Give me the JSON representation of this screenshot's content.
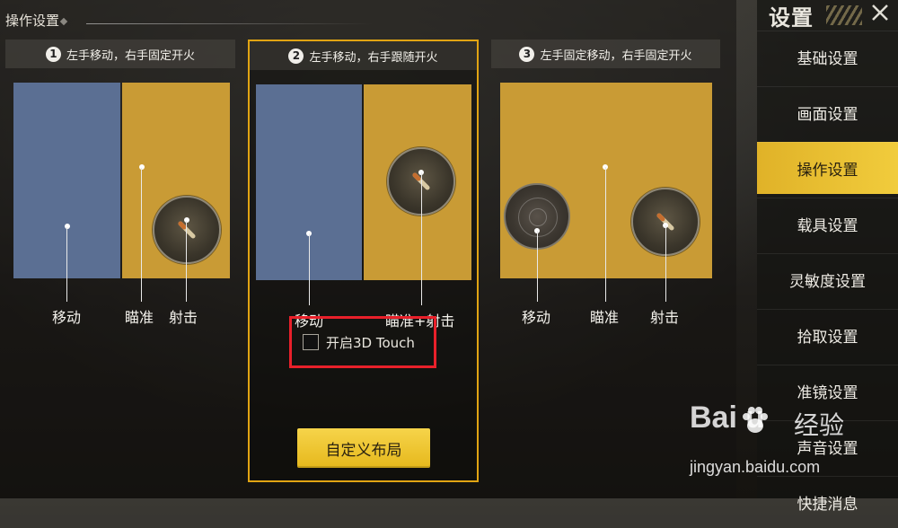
{
  "header": {
    "title": "操作设置"
  },
  "schemes": [
    {
      "num": "1",
      "title": "左手移动，右手固定开火",
      "labels": {
        "move": "移动",
        "aim": "瞄准",
        "fire": "射击"
      }
    },
    {
      "num": "2",
      "title": "左手移动，右手跟随开火",
      "labels": {
        "move": "移动",
        "aim_fire": "瞄准+射击"
      }
    },
    {
      "num": "3",
      "title": "左手固定移动，右手固定开火",
      "labels": {
        "move": "移动",
        "aim": "瞄准",
        "fire": "射击"
      }
    }
  ],
  "touch3d": {
    "label": "开启3D Touch",
    "checked": false
  },
  "custom_layout_button": "自定义布局",
  "sidebar": {
    "title": "设置",
    "items": [
      {
        "label": "基础设置",
        "active": false
      },
      {
        "label": "画面设置",
        "active": false
      },
      {
        "label": "操作设置",
        "active": true
      },
      {
        "label": "载具设置",
        "active": false
      },
      {
        "label": "灵敏度设置",
        "active": false
      },
      {
        "label": "拾取设置",
        "active": false
      },
      {
        "label": "准镜设置",
        "active": false
      },
      {
        "label": "声音设置",
        "active": false
      },
      {
        "label": "快捷消息",
        "active": false
      }
    ]
  },
  "watermark": {
    "logo": "Bai  u",
    "brand": "经验",
    "url": "jingyan.baidu.com"
  },
  "colors": {
    "accent": "#e1a413",
    "highlight": "#e8202a",
    "blue_zone": "#5b6f93",
    "gold_zone": "#c99b35"
  }
}
